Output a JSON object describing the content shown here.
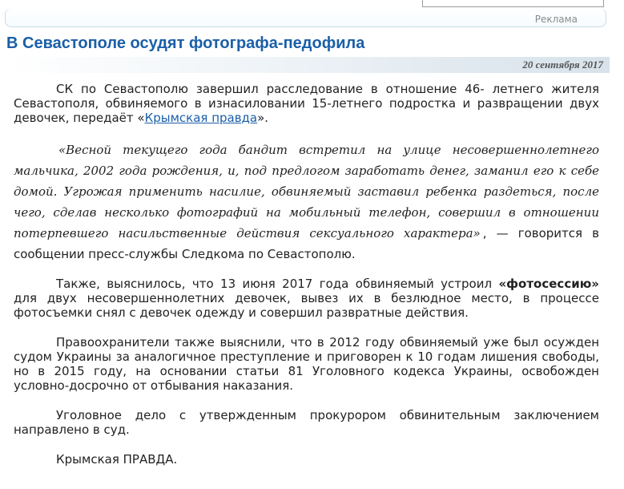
{
  "ad": {
    "label": "Реклама"
  },
  "article": {
    "title": "В Севастополе осудят фотографа-педофила",
    "date": "20 сентября 2017",
    "p1": {
      "text": "СК по Севастополю завершил расследование в отношение 46- летнего жителя Севастополя, обвиняемого в изнасиловании 15-летнего подростка и развращении двух девочек, передаёт «",
      "link": "Крымская правда",
      "end": "»."
    },
    "p2": {
      "quote": "«Весной текущего года бандит встретил на улице несовершеннолетнего мальчика, 2002 года рождения, и, под предлогом заработать денег, заманил его к себе домой. Угрожая применить насилие, обвиняемый заставил ребенка раздеться, после чего, сделав несколько фотографий на мобильный телефон, совершил в отношении потерпевшего насильственные действия сексуального характера»",
      "tail": ", — говорится в сообщении пресс-службы Следкома по Севастополю."
    },
    "p3": {
      "start": "Также, выяснилось, что 13 июня 2017 года обвиняемый устроил ",
      "bold": "«фотосессию»",
      "end": " для двух несовершеннолетних девочек, вывез их в безлюдное место, в процессе фотосъемки снял с девочек одежду и совершил развратные действия."
    },
    "p4": "Правоохранители также выяснили, что в 2012 году обвиняемый уже был осужден судом Украины за аналогичное преступление и приговорен к 10 годам лишения свободы, но в 2015 году, на основании статьи 81 Уголовного кодекса Украины, освобожден условно-досрочно от отбывания наказания.",
    "p5": "Уголовное дело с утвержденным прокурором обвинительным заключением направлено в суд.",
    "p6": "Крымская ПРАВДА."
  }
}
